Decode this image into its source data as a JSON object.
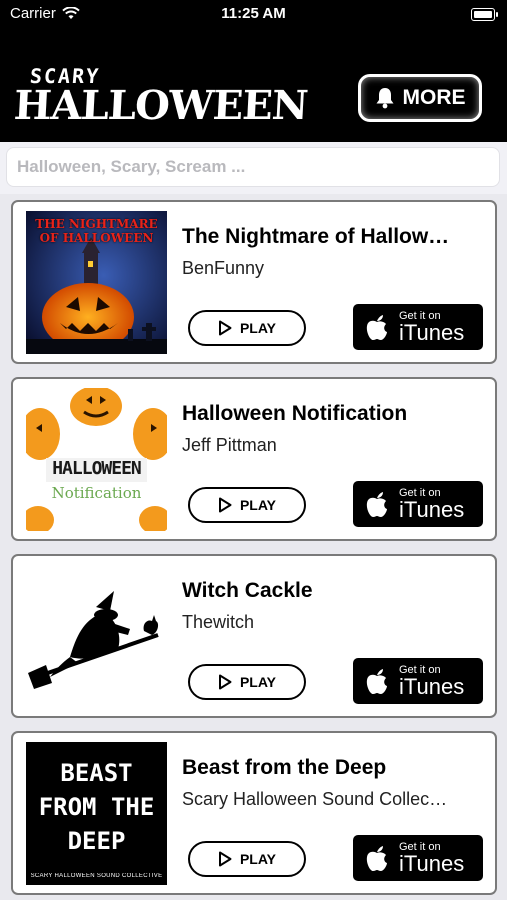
{
  "status_bar": {
    "carrier": "Carrier",
    "time": "11:25 AM"
  },
  "header": {
    "logo_top": "SCARY",
    "logo_bottom": "HALLOWEEN",
    "more_label": "MORE"
  },
  "search": {
    "placeholder": "Halloween, Scary, Scream ..."
  },
  "songs": [
    {
      "title": "The Nightmare of Hallow…",
      "artist": "BenFunny",
      "thumb_text": "THE NIGHTMARE OF HALLOWEEN",
      "play_label": "PLAY",
      "itunes_small": "Get it on",
      "itunes_big": "iTunes"
    },
    {
      "title": "Halloween Notification",
      "artist": "Jeff Pittman",
      "thumb_text": "HALLOWEEN",
      "thumb_subtext": "Notification",
      "play_label": "PLAY",
      "itunes_small": "Get it on",
      "itunes_big": "iTunes"
    },
    {
      "title": "Witch Cackle",
      "artist": "Thewitch",
      "play_label": "PLAY",
      "itunes_small": "Get it on",
      "itunes_big": "iTunes"
    },
    {
      "title": "Beast from the Deep",
      "artist": "Scary Halloween Sound Collec…",
      "thumb_text": "BEAST FROM THE DEEP",
      "thumb_subtext": "SCARY HALLOWEEN SOUND COLLECTIVE",
      "play_label": "PLAY",
      "itunes_small": "Get it on",
      "itunes_big": "iTunes"
    }
  ],
  "colors": {
    "header_bg": "#000000",
    "page_bg": "#e9e9ee",
    "card_border": "#7a7a7a",
    "button_bg": "#000000"
  }
}
